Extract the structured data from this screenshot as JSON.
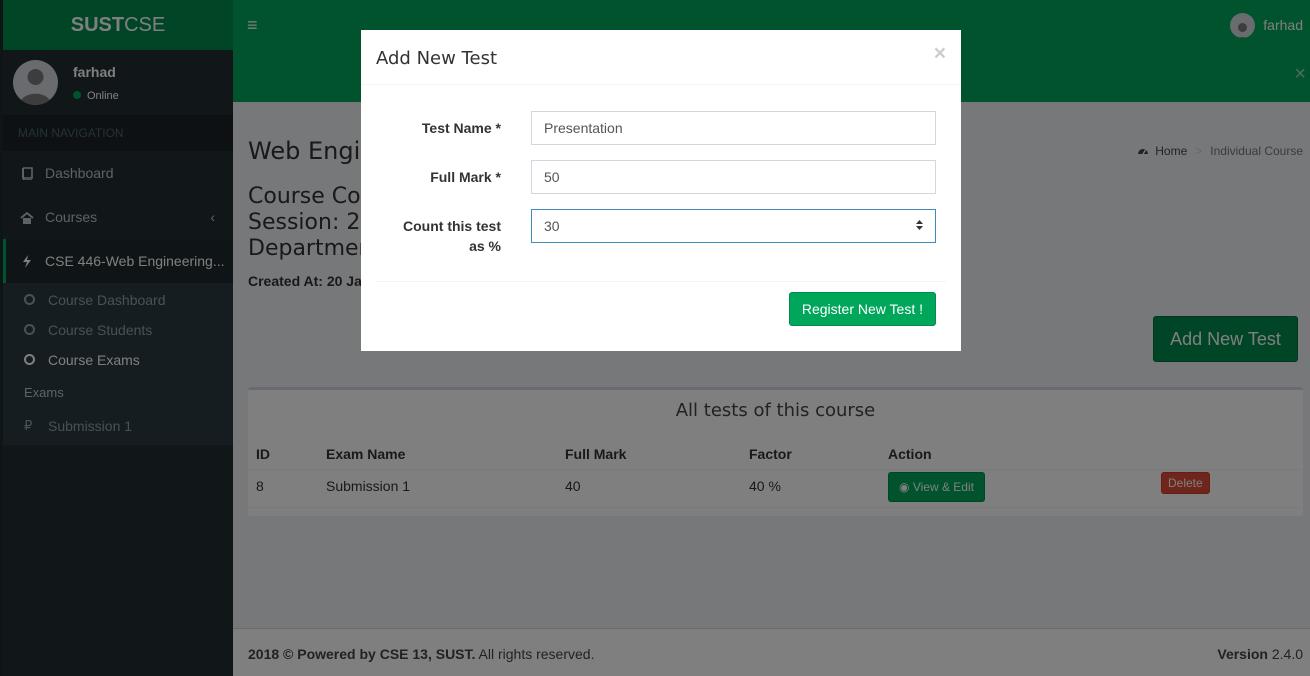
{
  "app": {
    "logo_bold": "SUST",
    "logo_light": "CSE"
  },
  "user": {
    "name": "farhad",
    "status": "Online"
  },
  "sidebar": {
    "header": "MAIN NAVIGATION",
    "items": [
      {
        "label": "Dashboard",
        "icon": "book-icon"
      },
      {
        "label": "Courses",
        "icon": "home-icon"
      },
      {
        "label": "CSE 446-Web Engineering...",
        "icon": "bolt-icon"
      }
    ],
    "subitems": [
      {
        "label": "Course Dashboard"
      },
      {
        "label": "Course Students"
      },
      {
        "label": "Course Exams"
      }
    ],
    "exams_label": "Exams",
    "exam_items": [
      {
        "label": "Submission 1"
      }
    ]
  },
  "navbar": {
    "user_name": "farhad"
  },
  "page": {
    "title": "Web Engin",
    "course_line1": "Course Co",
    "course_line2": "Session: 2",
    "course_line3": "Departmen",
    "created": "Created At: 20 Ja",
    "add_test_label": "Add New Test"
  },
  "breadcrumb": {
    "home": "Home",
    "current": "Individual Course"
  },
  "tests_box": {
    "title": "All tests of this course",
    "columns": [
      "ID",
      "Exam Name",
      "Full Mark",
      "Factor",
      "Action"
    ],
    "rows": [
      {
        "id": "8",
        "name": "Submission 1",
        "full_mark": "40",
        "factor": "40 %",
        "view_label": "View & Edit",
        "delete_label": "Delete"
      }
    ]
  },
  "footer": {
    "copyright_bold": "2018 © Powered by CSE 13, SUST.",
    "copyright_rest": " All rights reserved.",
    "version_label": "Version",
    "version_value": "2.4.0"
  },
  "modal": {
    "title": "Add New Test",
    "close_glyph": "×",
    "fields": {
      "test_name_label": "Test Name *",
      "test_name_value": "Presentation",
      "full_mark_label": "Full Mark *",
      "full_mark_value": "50",
      "count_label_line1": "Count this test",
      "count_label_line2": "as %",
      "count_value": "30"
    },
    "submit_label": "Register New Test !"
  },
  "colors": {
    "brand": "#00a65a",
    "brand_dark": "#008d4c",
    "sidebar_bg": "#222d32",
    "danger": "#dd4b39"
  }
}
